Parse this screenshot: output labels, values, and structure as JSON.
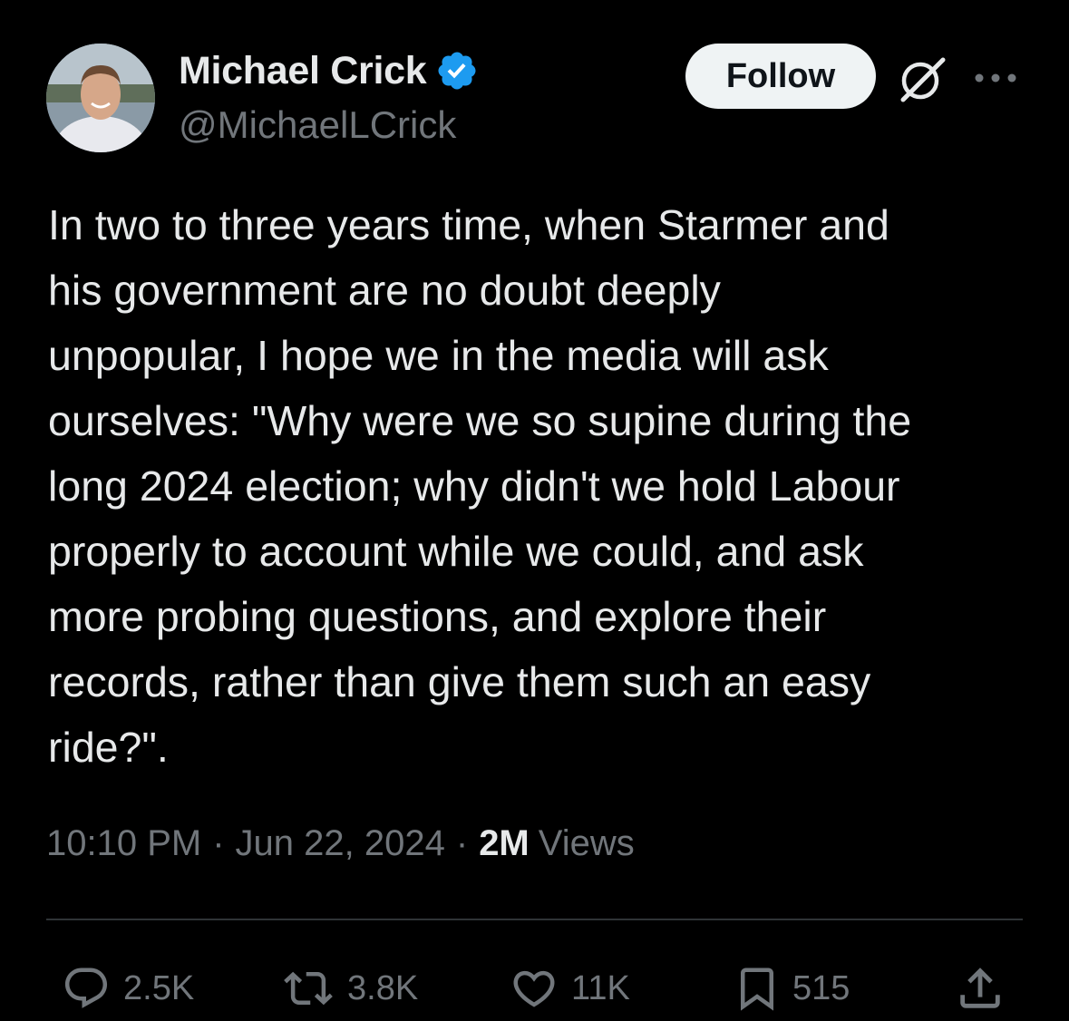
{
  "author": {
    "display_name": "Michael Crick",
    "handle": "@MichaelLCrick",
    "verified": true
  },
  "header": {
    "follow_label": "Follow",
    "icons": [
      "grok-icon",
      "more-icon"
    ]
  },
  "tweet": {
    "text": "In two to three years time, when Starmer and\nhis government are no doubt deeply\nunpopular, I hope we in the media will ask\nourselves: \"Why were we so supine during the\nlong 2024 election; why didn't we hold Labour\nproperly to account while we could, and ask\nmore probing questions, and explore their\nrecords, rather than give them such an easy\nride?\".",
    "time": "10:10 PM",
    "separator": "·",
    "date": "Jun 22, 2024",
    "views_count": "2M",
    "views_label": "Views"
  },
  "actions": {
    "replies": "2.5K",
    "reposts": "3.8K",
    "likes": "11K",
    "bookmarks": "515"
  },
  "colors": {
    "background": "#000000",
    "primary_text": "#e7e9ea",
    "secondary_text": "#71767b",
    "verified_blue": "#1d9bf0",
    "follow_button_bg": "#eff3f4"
  }
}
